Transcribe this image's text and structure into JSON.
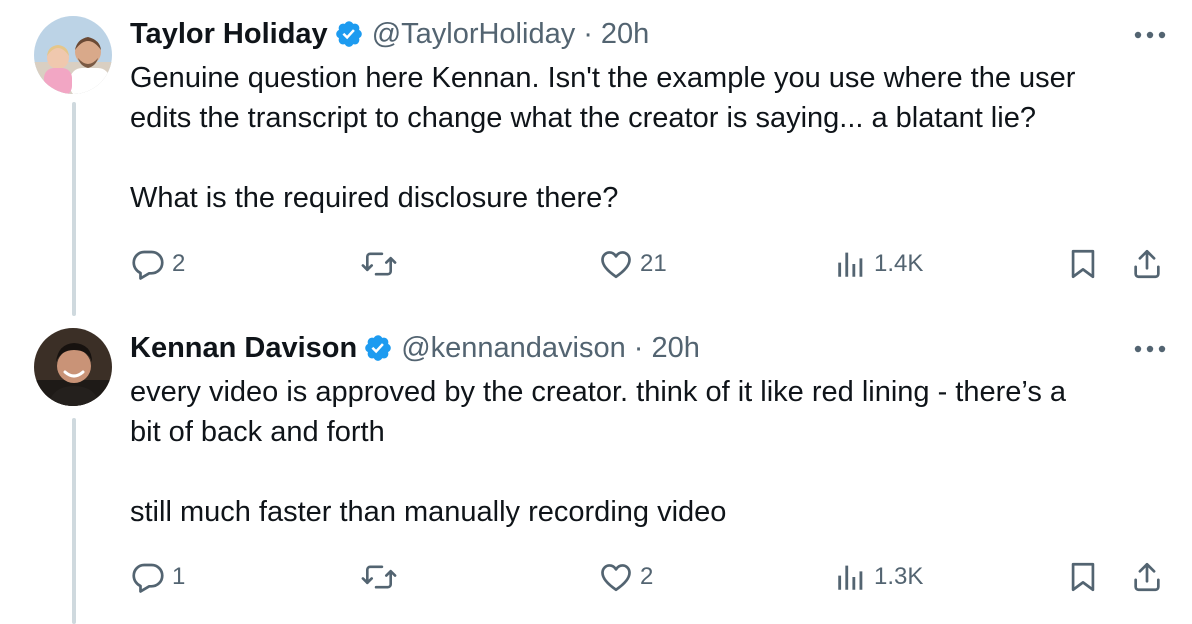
{
  "tweets": [
    {
      "author": {
        "name": "Taylor Holiday",
        "handle": "@TaylorHoliday",
        "verified": true,
        "avatar": "avatar-man-with-child"
      },
      "time": "20h",
      "separator": "·",
      "text_lines": [
        "Genuine question here Kennan. Isn't the example you use where the user",
        "edits the transcript to change what the creator is saying... a blatant lie?",
        "What is the required disclosure there?"
      ],
      "replies": "2",
      "reposts": "",
      "likes": "21",
      "views": "1.4K"
    },
    {
      "author": {
        "name": "Kennan Davison",
        "handle": "@kennandavison",
        "verified": true,
        "avatar": "avatar-smiling-man"
      },
      "time": "20h",
      "separator": "·",
      "text_lines": [
        "every video is approved by the creator. think of it like red lining - there’s a",
        "bit of back and forth",
        "still much faster than manually recording video"
      ],
      "replies": "1",
      "reposts": "",
      "likes": "2",
      "views": "1.3K"
    }
  ],
  "colors": {
    "text": "#0f1419",
    "secondary": "#536471",
    "verified": "#1d9bf0",
    "thread_line": "#cfd9de"
  }
}
